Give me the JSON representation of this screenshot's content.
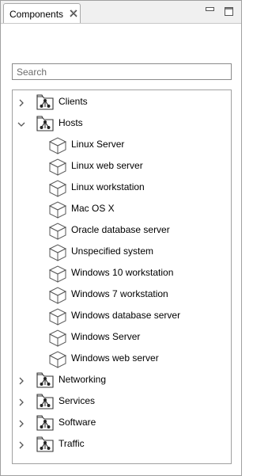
{
  "tab": {
    "title": "Components"
  },
  "search": {
    "placeholder": "Search"
  },
  "tree": [
    {
      "label": "Clients",
      "type": "group",
      "expanded": false
    },
    {
      "label": "Hosts",
      "type": "group",
      "expanded": true
    },
    {
      "label": "Linux Server",
      "type": "item"
    },
    {
      "label": "Linux web server",
      "type": "item"
    },
    {
      "label": "Linux workstation",
      "type": "item"
    },
    {
      "label": "Mac OS X",
      "type": "item"
    },
    {
      "label": "Oracle database server",
      "type": "item"
    },
    {
      "label": "Unspecified system",
      "type": "item"
    },
    {
      "label": "Windows 10 workstation",
      "type": "item"
    },
    {
      "label": "Windows 7 workstation",
      "type": "item"
    },
    {
      "label": "Windows database server",
      "type": "item"
    },
    {
      "label": "Windows Server",
      "type": "item"
    },
    {
      "label": "Windows web server",
      "type": "item"
    },
    {
      "label": "Networking",
      "type": "group",
      "expanded": false
    },
    {
      "label": "Services",
      "type": "group",
      "expanded": false
    },
    {
      "label": "Software",
      "type": "group",
      "expanded": false
    },
    {
      "label": "Traffic",
      "type": "group",
      "expanded": false
    }
  ]
}
